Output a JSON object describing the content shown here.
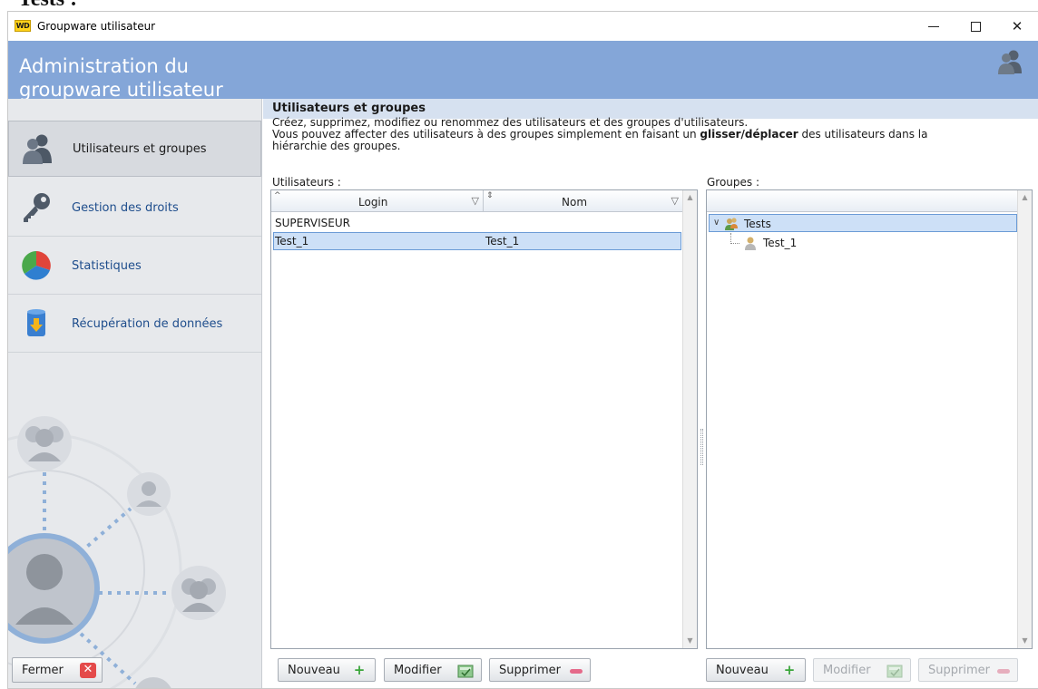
{
  "page": {
    "caption": "Tests :"
  },
  "window": {
    "title": "Groupware utilisateur",
    "logo_text": "WD"
  },
  "header": {
    "title": "Administration du groupware utilisateur"
  },
  "sidebar": {
    "items": [
      {
        "label": "Utilisateurs et groupes",
        "icon": "users-icon"
      },
      {
        "label": "Gestion des droits",
        "icon": "key-icon"
      },
      {
        "label": "Statistiques",
        "icon": "pie-chart-icon"
      },
      {
        "label": "Récupération de données",
        "icon": "database-restore-icon"
      }
    ],
    "close_label": "Fermer"
  },
  "main": {
    "section_title": "Utilisateurs et groupes",
    "description_line1": "Créez, supprimez, modifiez ou renommez des utilisateurs et des groupes d'utilisateurs.",
    "description_line2_pre": "Vous pouvez affecter des utilisateurs à des groupes simplement en faisant un ",
    "description_line2_bold": "glisser/déplacer",
    "description_line2_post": " des utilisateurs dans la",
    "description_line3": "hiérarchie des groupes.",
    "users": {
      "label": "Utilisateurs :",
      "columns": [
        "Login",
        "Nom"
      ],
      "rows": [
        {
          "login": "SUPERVISEUR",
          "nom": ""
        },
        {
          "login": "Test_1",
          "nom": "Test_1"
        }
      ],
      "selected_row": 1
    },
    "groups": {
      "label": "Groupes :",
      "tree": [
        {
          "label": "Tests",
          "children": [
            {
              "label": "Test_1"
            }
          ]
        }
      ]
    },
    "buttons": {
      "new": "Nouveau",
      "edit": "Modifier",
      "delete": "Supprimer"
    }
  },
  "colors": {
    "header_band": "#84a6d8",
    "section_bar": "#d6e1f0",
    "selection": "#cde0f7",
    "link": "#1e4d8c"
  }
}
